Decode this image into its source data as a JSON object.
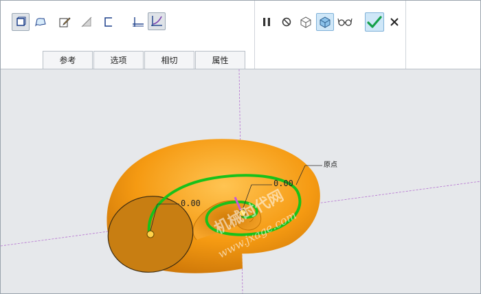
{
  "tabs": [
    {
      "label": "参考"
    },
    {
      "label": "选项"
    },
    {
      "label": "相切"
    },
    {
      "label": "属性"
    }
  ],
  "toolbar": {
    "solid_icon": "solid-cube-icon",
    "surface_icon": "surface-icon",
    "sketch_icon": "sketch-pencil-icon",
    "remove_material_icon": "remove-material-icon",
    "thicken_icon": "thicken-icon",
    "constant_section_icon": "constant-section-icon",
    "variable_section_icon": "variable-section-icon",
    "pause_icon": "pause-icon",
    "no_preview_icon": "no-preview-icon",
    "attach_preview_icon": "attach-preview-icon",
    "detail_preview_icon": "detail-preview-icon",
    "verify_icon": "glasses-icon",
    "ok_icon": "check-icon",
    "cancel_icon": "close-icon"
  },
  "viewport": {
    "dim_outer": "0.00",
    "dim_left": "0.00",
    "origin_label": "原点",
    "watermark_cn": "机械时代网",
    "watermark_url": "www.jxage.com",
    "colors": {
      "shell": "#f39a12",
      "shell_dark": "#b86a05",
      "section_face": "#c87e12",
      "trajectory": "#19c11a",
      "axis_line": "#b46fd0",
      "background": "#e6e8eb"
    }
  }
}
